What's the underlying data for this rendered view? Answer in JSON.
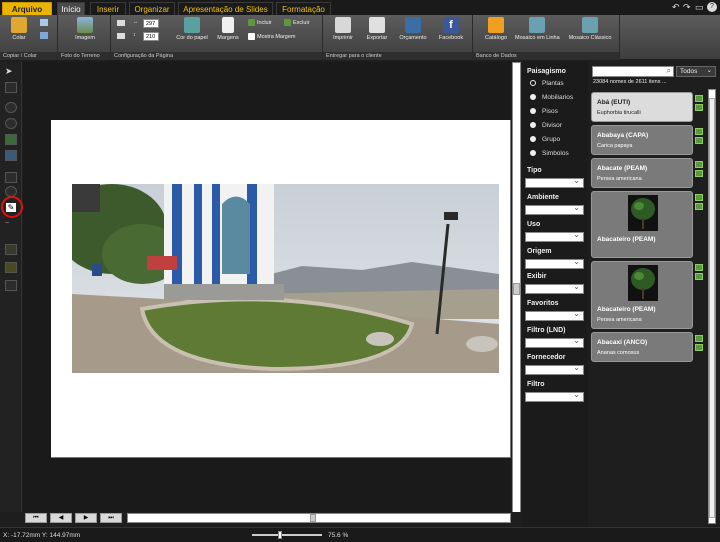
{
  "tabs": [
    {
      "label": "Arquivo"
    },
    {
      "label": "Início"
    },
    {
      "label": "Inserir"
    },
    {
      "label": "Organizar"
    },
    {
      "label": "Apresentação de Slides"
    },
    {
      "label": "Formatação"
    }
  ],
  "ribbon": {
    "clipboard": {
      "paste": "Colar",
      "group": "Copiar / Colar"
    },
    "terrain": {
      "image": "Imagem",
      "group": "Foto do Terreno"
    },
    "page": {
      "width": "297",
      "height": "210",
      "paper_color": "Cor do papel",
      "margins": "Margens",
      "include": "Incluir",
      "exclude": "Excluir",
      "show_margin": "Mostra Margem",
      "group": "Configuração da Página"
    },
    "deliver": {
      "print": "Imprimir",
      "export": "Exportar",
      "budget": "Orçamento",
      "facebook": "Facebook",
      "group": "Entregar para o cliente"
    },
    "database": {
      "catalog": "Catálogo",
      "online_mosaic": "Mosaico em Linha",
      "classic_mosaic": "Mosaico Clássico",
      "group": "Banco de Dados"
    }
  },
  "status": {
    "coords": "X: -17.72mm Y: 144.97mm",
    "zoom": "75.6 %",
    "zoom_level": 0.4
  },
  "filters": {
    "landscaping": "Paisagismo",
    "radios": [
      "Plantas",
      "Mobiliarios",
      "Pisos",
      "Divisor",
      "Grupo",
      "Simbolos"
    ],
    "selected": "Plantas",
    "headers": [
      "Tipo",
      "Ambiente",
      "Uso",
      "Origem",
      "Exibir",
      "Favoritos",
      "Filtro (LND)",
      "Fornecedor",
      "Filtro"
    ]
  },
  "catalog": {
    "scope": "Todos",
    "count": "23084 nomes de 2611 itens ...",
    "items": [
      {
        "name": "Abá (EUTI)",
        "sci": "Euphorbia tirucalli"
      },
      {
        "name": "Ababaya (CAPA)",
        "sci": "Carica papaya"
      },
      {
        "name": "Abacate (PEAM)",
        "sci": "Persea americana"
      },
      {
        "name": "Abacateiro (PEAM)",
        "sci": ""
      },
      {
        "name": "Abacateiro (PEAM)",
        "sci": "Persea americana"
      },
      {
        "name": "Abacaxi (ANCO)",
        "sci": "Ananas comosus"
      }
    ]
  },
  "colors": {
    "accent": "#f2c200",
    "highlight": "#e01010"
  }
}
